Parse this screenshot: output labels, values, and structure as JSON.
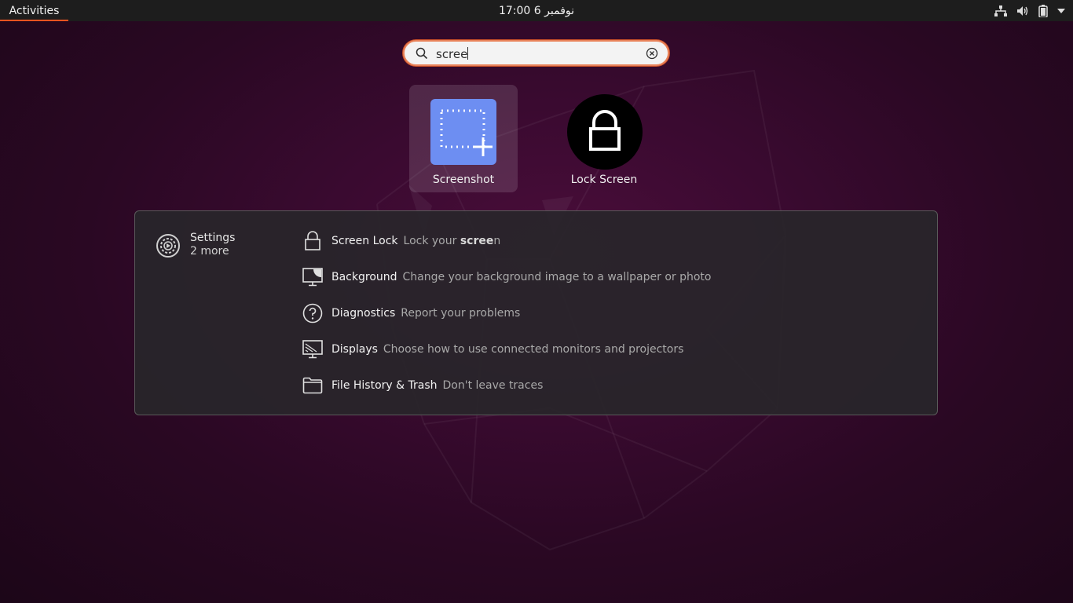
{
  "topbar": {
    "activities_label": "Activities",
    "clock": "نوفمبر 6  17:00",
    "tray": [
      "network-icon",
      "volume-icon",
      "battery-icon",
      "menu-arrow-icon"
    ]
  },
  "search": {
    "value": "scree",
    "icon": "search-icon",
    "clear_icon": "clear-icon"
  },
  "apps": [
    {
      "label": "Screenshot",
      "icon": "screenshot-icon",
      "selected": true
    },
    {
      "label": "Lock Screen",
      "icon": "lock-icon",
      "selected": false
    }
  ],
  "settings": {
    "provider_name": "Settings",
    "provider_more": "2 more",
    "results": [
      {
        "title": "Screen Lock",
        "desc_before": "Lock your ",
        "desc_match": "scree",
        "desc_after": "n",
        "icon": "padlock-icon"
      },
      {
        "title": "Background",
        "desc": "Change your background image to a wallpaper or photo",
        "icon": "background-icon"
      },
      {
        "title": "Diagnostics",
        "desc": "Report your problems",
        "icon": "help-icon"
      },
      {
        "title": "Displays",
        "desc": "Choose how to use connected monitors and projectors",
        "icon": "display-icon"
      },
      {
        "title": "File History & Trash",
        "desc": "Don't leave traces",
        "icon": "folder-icon"
      }
    ]
  },
  "colors": {
    "accent": "#e95420",
    "topbar": "#1d1d1d",
    "panel_bg": "#2a282c",
    "screenshot_icon": "#6d8ef2"
  }
}
